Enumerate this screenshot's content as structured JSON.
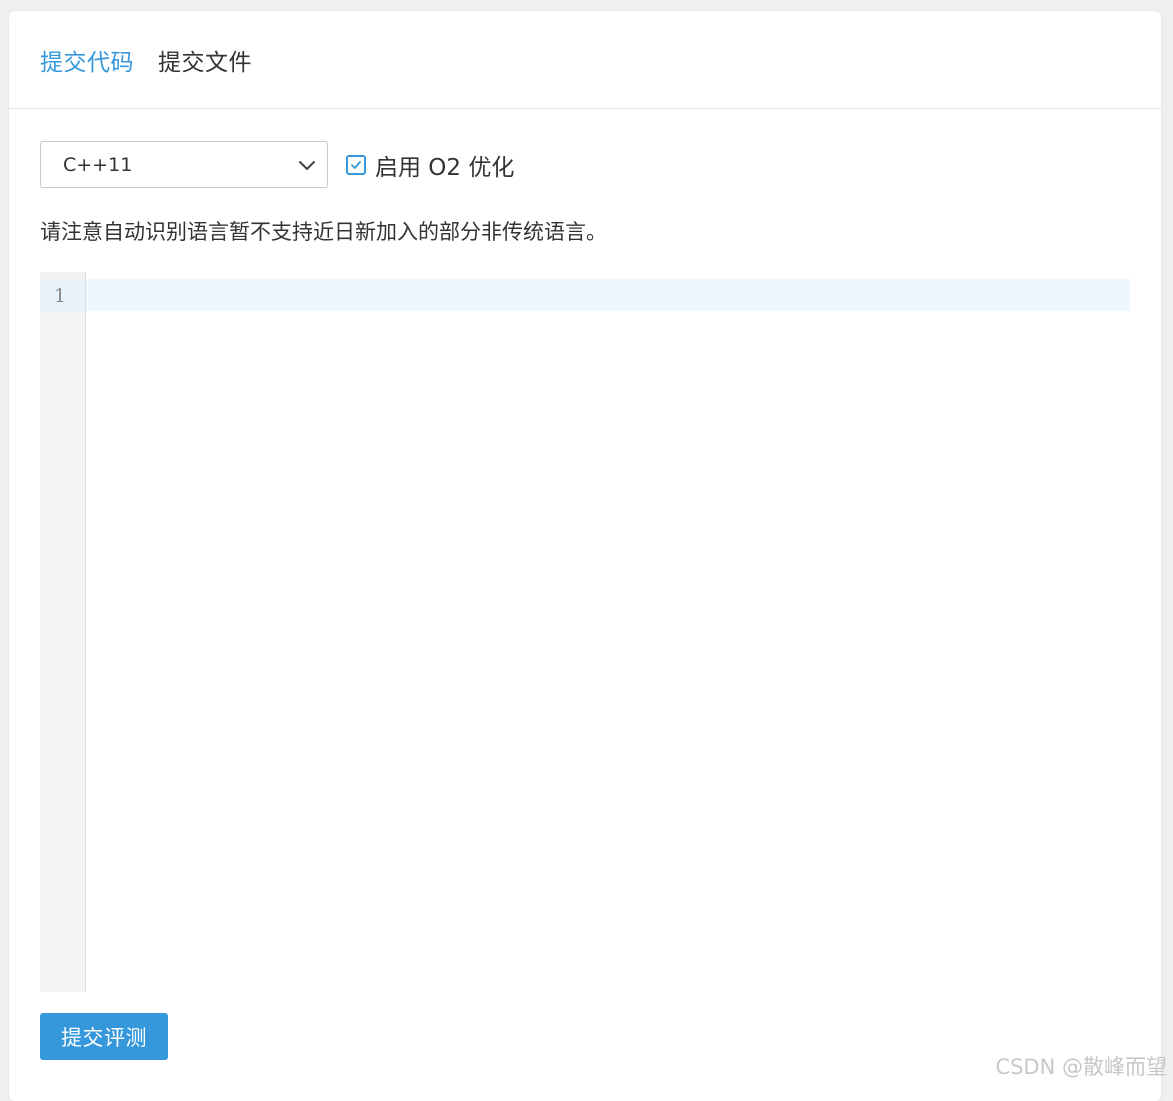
{
  "tabs": [
    {
      "label": "提交代码",
      "active": true
    },
    {
      "label": "提交文件",
      "active": false
    }
  ],
  "language_select": {
    "value": "C++11"
  },
  "o2_option": {
    "label": "启用 O2 优化",
    "checked": true
  },
  "notice": "请注意自动识别语言暂不支持近日新加入的部分非传统语言。",
  "editor": {
    "line_numbers": [
      "1"
    ],
    "code": ""
  },
  "submit_label": "提交评测",
  "watermark": "CSDN @散峰而望",
  "colors": {
    "accent": "#3498db",
    "active_line": "#eef7ff",
    "gutter": "#f3f3f3"
  }
}
